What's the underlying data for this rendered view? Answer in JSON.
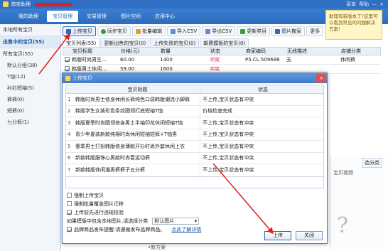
{
  "app": {
    "title": "淘宝助理"
  },
  "window_controls": {
    "user_label": "菜单",
    "help_label": "帮助",
    "min": "—",
    "close": "×"
  },
  "nav": {
    "tabs": [
      "我的助理",
      "宝贝管理",
      "交易管理",
      "图片空间",
      "应用中心"
    ],
    "active": 1
  },
  "help_bubble": {
    "text": "助理有新版本了?这里可以看到常见的问题解决方案!"
  },
  "sidebar": {
    "header": "本地所有宝贝",
    "highlight": "出售中的宝贝(55)",
    "root": "所有宝贝(55)",
    "items": [
      "默认分组(38)",
      "T恤(12)",
      "衬衫短袖(5)",
      "裤裤(0)",
      "短裤(0)",
      "七分裤(1)"
    ]
  },
  "toolbar": {
    "buttons": [
      "上传宝贝",
      "同步宝贝",
      "批量编辑",
      "导入CSV",
      "导出CSV",
      "更新类目",
      "图片搬家",
      "更多"
    ]
  },
  "subtabs": [
    "宝贝列表(55)",
    "更新出售的宝贝(0)",
    "上传失败的宝贝(0)",
    "邮费模板的宝贝(0)"
  ],
  "main_table": {
    "headers": [
      "",
      "宝贝标题",
      "价格(元)",
      "数量",
      "",
      "状态",
      "商家编码",
      "无线描述",
      "",
      "店铺分类"
    ],
    "rows": [
      {
        "title": "韩版时尚男生...",
        "price": "60.00",
        "qty": "1400",
        "status": "冲突",
        "code": "P5.CL.509688",
        "wireless": "无",
        "category": "休闲裤"
      },
      {
        "title": "韩版男士休闲...",
        "price": "59.00",
        "qty": "1600",
        "status": "冲突",
        "code": "",
        "wireless": "",
        "category": ""
      }
    ]
  },
  "modal": {
    "title": "上传宝贝",
    "close": "×",
    "headers": {
      "title": "宝贝标题",
      "status": "状态"
    },
    "rows": [
      {
        "idx": "1",
        "title": "韩版时尚男士修身休闲长裤纯色口袋韩版潮流小脚裤",
        "status": "不上传,宝贝状态有冲突"
      },
      {
        "idx": "2",
        "title": "韩版学生女装彩色条纹圆领打底短袖T恤",
        "status": "价格检查完成"
      },
      {
        "idx": "3",
        "title": "韩版夏季时尚圆领修身男士半袖印花休闲短袖T恤",
        "status": "不上传,宝贝状态有冲突"
      },
      {
        "idx": "4",
        "title": "青少年夏装新款纯棉时尚休闲短袖短裤+T恤男",
        "status": "不上传,宝贝状态有冲突"
      },
      {
        "idx": "5",
        "title": "春季男士打扮韩版修身薄款开衫时尚外套休闲上衣",
        "status": "不上传,宝贝状态有冲突"
      },
      {
        "idx": "6",
        "title": "新款韩版服饰心男款时尚春运动裤",
        "status": "不上传,宝贝状态有冲突"
      },
      {
        "idx": "7",
        "title": "新款韩版休闲潮男裤裤子五分裤",
        "status": "不上传,宝贝状态有冲突"
      }
    ],
    "options": {
      "force_upload": "强制上传宝贝",
      "force_bulk": "强制批量覆盖图片迁移",
      "check_image": "上传前先进行违规校验",
      "image_category_prefix": "如果模版中包含本地图片,请选择分类",
      "image_category_value": "默认图片",
      "brand_label": "品牌商品发布提醒:请遵循发布品牌商品。",
      "brand_link": "点此了解详情"
    },
    "buttons": {
      "upload": "上传",
      "close": "关闭"
    }
  },
  "right_panel": {
    "button": "选分类",
    "label": "宝贝视频"
  },
  "bottom_strip": {
    "label": "•新方案"
  },
  "colors": {
    "accent": "#2c6bbd",
    "conflict": "#d23333",
    "arrow": "#e02020"
  }
}
